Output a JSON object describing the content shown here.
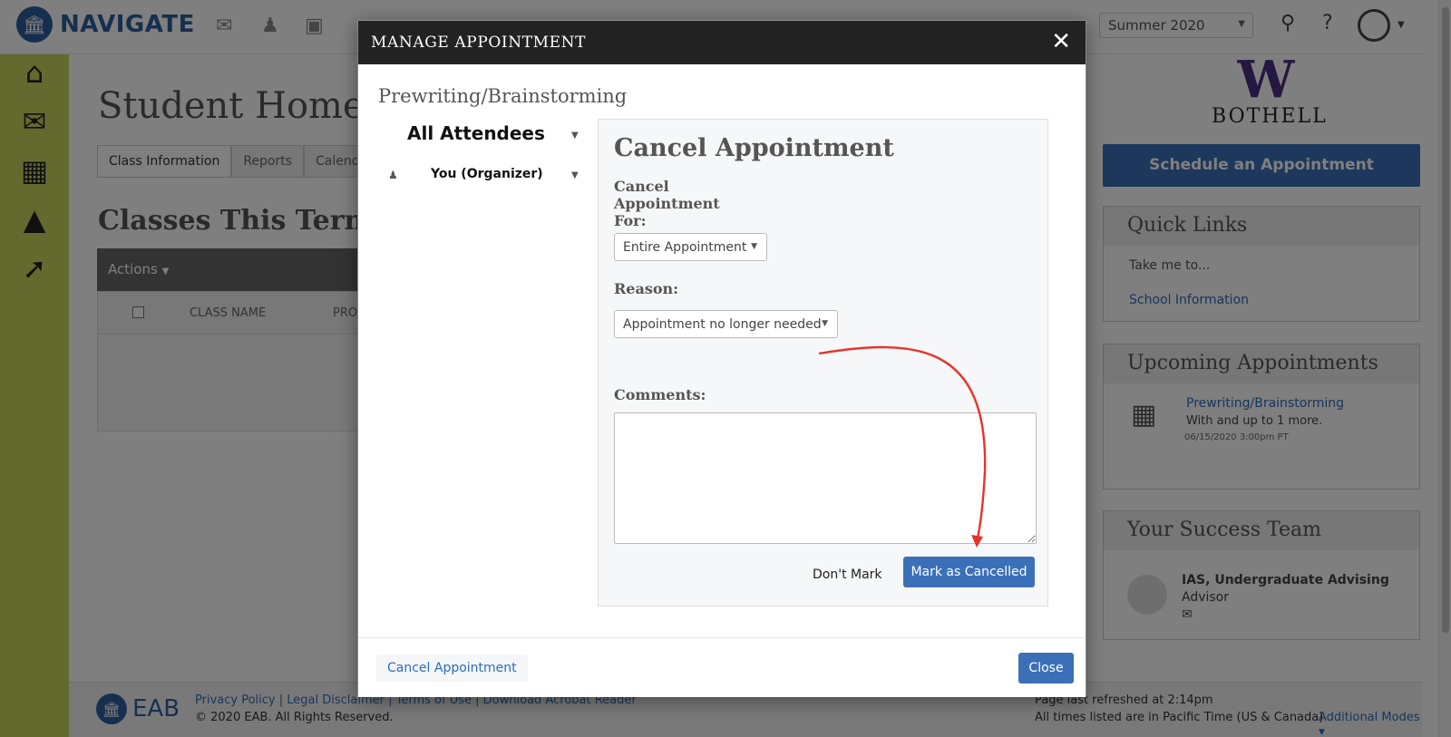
{
  "topbar": {
    "logo_text": "NAVIGATE",
    "term_value": "Summer 2020"
  },
  "page": {
    "title": "Student Home",
    "tabs": [
      {
        "label": "Class Information"
      },
      {
        "label": "Reports"
      },
      {
        "label": "Calendar"
      }
    ],
    "section_title": "Classes This Term",
    "actions_label": "Actions",
    "columns": [
      "CLASS NAME",
      "PRO"
    ]
  },
  "sidebar_right": {
    "uw_wordmark": "BOTHELL",
    "schedule_button": "Schedule an Appointment",
    "quick_links": {
      "title": "Quick Links",
      "intro": "Take me to...",
      "link": "School Information"
    },
    "upcoming": {
      "title": "Upcoming Appointments",
      "appt_link": "Prewriting/Brainstorming",
      "appt_with": "With and up to 1 more.",
      "appt_time": "06/15/2020 3:00pm PT"
    },
    "success_team": {
      "title": "Your Success Team",
      "name": "IAS, Undergraduate Advising",
      "role": "Advisor"
    }
  },
  "footer": {
    "eab_text": "EAB",
    "links": [
      "Privacy Policy",
      "Legal Disclaimer",
      "Terms of Use",
      "Download Acrobat Reader"
    ],
    "copyright": "© 2020 EAB. All Rights Reserved.",
    "refreshed": "Page last refreshed at 2:14pm",
    "timezone": "All times listed are in Pacific Time (US & Canada)",
    "modes": "Additional Modes"
  },
  "modal": {
    "title": "MANAGE APPOINTMENT",
    "appointment_name": "Prewriting/Brainstorming",
    "attendees_title": "All Attendees",
    "organizer": "You (Organizer)",
    "cancel_heading": "Cancel Appointment",
    "cancel_for_label": "Cancel Appointment For:",
    "cancel_for_line1": "Cancel",
    "cancel_for_line2": "Appointment",
    "cancel_for_line3": "For:",
    "cancel_for_value": "Entire Appointment",
    "reason_label": "Reason:",
    "reason_value": "Appointment no longer needed",
    "comments_label": "Comments:",
    "dont_mark": "Don't Mark",
    "mark_cancelled": "Mark as Cancelled",
    "footer_cancel": "Cancel Appointment",
    "footer_close": "Close"
  },
  "colors": {
    "primary_blue": "#3b70b8",
    "modal_header": "#222222",
    "nav_green": "#c8d45c",
    "uw_purple": "#4b2e83",
    "annotation_red": "#e8332a"
  }
}
